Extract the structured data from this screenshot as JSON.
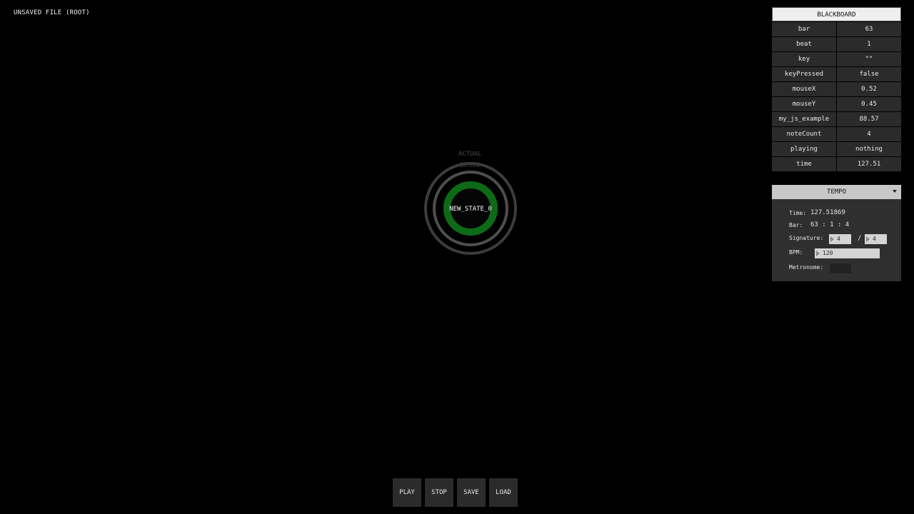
{
  "file": {
    "title": "UNSAVED FILE (ROOT)"
  },
  "blackboard": {
    "title": "BLACKBOARD",
    "rows": [
      {
        "key": "bar",
        "value": "63"
      },
      {
        "key": "beat",
        "value": "1"
      },
      {
        "key": "key",
        "value": "\"\""
      },
      {
        "key": "keyPressed",
        "value": "false"
      },
      {
        "key": "mouseX",
        "value": "0.52"
      },
      {
        "key": "mouseY",
        "value": "0.45"
      },
      {
        "key": "my_js_example",
        "value": "88.57"
      },
      {
        "key": "noteCount",
        "value": "4"
      },
      {
        "key": "playing",
        "value": "nothing"
      },
      {
        "key": "time",
        "value": "127.51"
      }
    ]
  },
  "tempo": {
    "title": "TEMPO",
    "time_label": "Time:",
    "time_value": "127.51869",
    "bar_label": "Bar:",
    "bar_value": "63 : 1 : 4",
    "signature_label": "Signature:",
    "signature_numerator": "4",
    "signature_separator": "/",
    "signature_denominator": "4",
    "bpm_label": "BPM:",
    "bpm_value": "120",
    "metronome_label": "Metronome:"
  },
  "state": {
    "actual_label": "ACTUAL",
    "begin_label": "BEGIN",
    "name": "NEW_STATE_0",
    "ring_color": "#0d6b17"
  },
  "controls": {
    "play_label": "PLAY",
    "stop_label": "STOP",
    "save_label": "SAVE",
    "load_label": "LOAD"
  }
}
